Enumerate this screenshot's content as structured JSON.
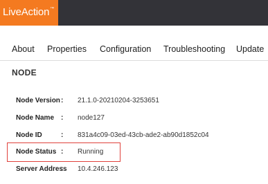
{
  "header": {
    "logo_text": "LiveAction",
    "logo_mark": "™"
  },
  "tabs": [
    {
      "label": "About"
    },
    {
      "label": "Properties"
    },
    {
      "label": "Configuration"
    },
    {
      "label": "Troubleshooting"
    },
    {
      "label": "Update"
    }
  ],
  "section": {
    "title": "NODE"
  },
  "fields": [
    {
      "label": "Node Version",
      "colon": ":",
      "value": "21.1.0-20210204-3253651"
    },
    {
      "label": "Node Name",
      "colon": ":",
      "value": "node127"
    },
    {
      "label": "Node ID",
      "colon": ":",
      "value": "831a4c09-03ed-43cb-ade2-ab90d1852c04"
    },
    {
      "label": "Node Status",
      "colon": ":",
      "value": "Running"
    },
    {
      "label": "Server Address",
      "colon": ":",
      "value": "10.4.246.123"
    }
  ],
  "colors": {
    "topbar": "#333338",
    "brand": "#f47a20",
    "highlight": "#e0403a"
  }
}
